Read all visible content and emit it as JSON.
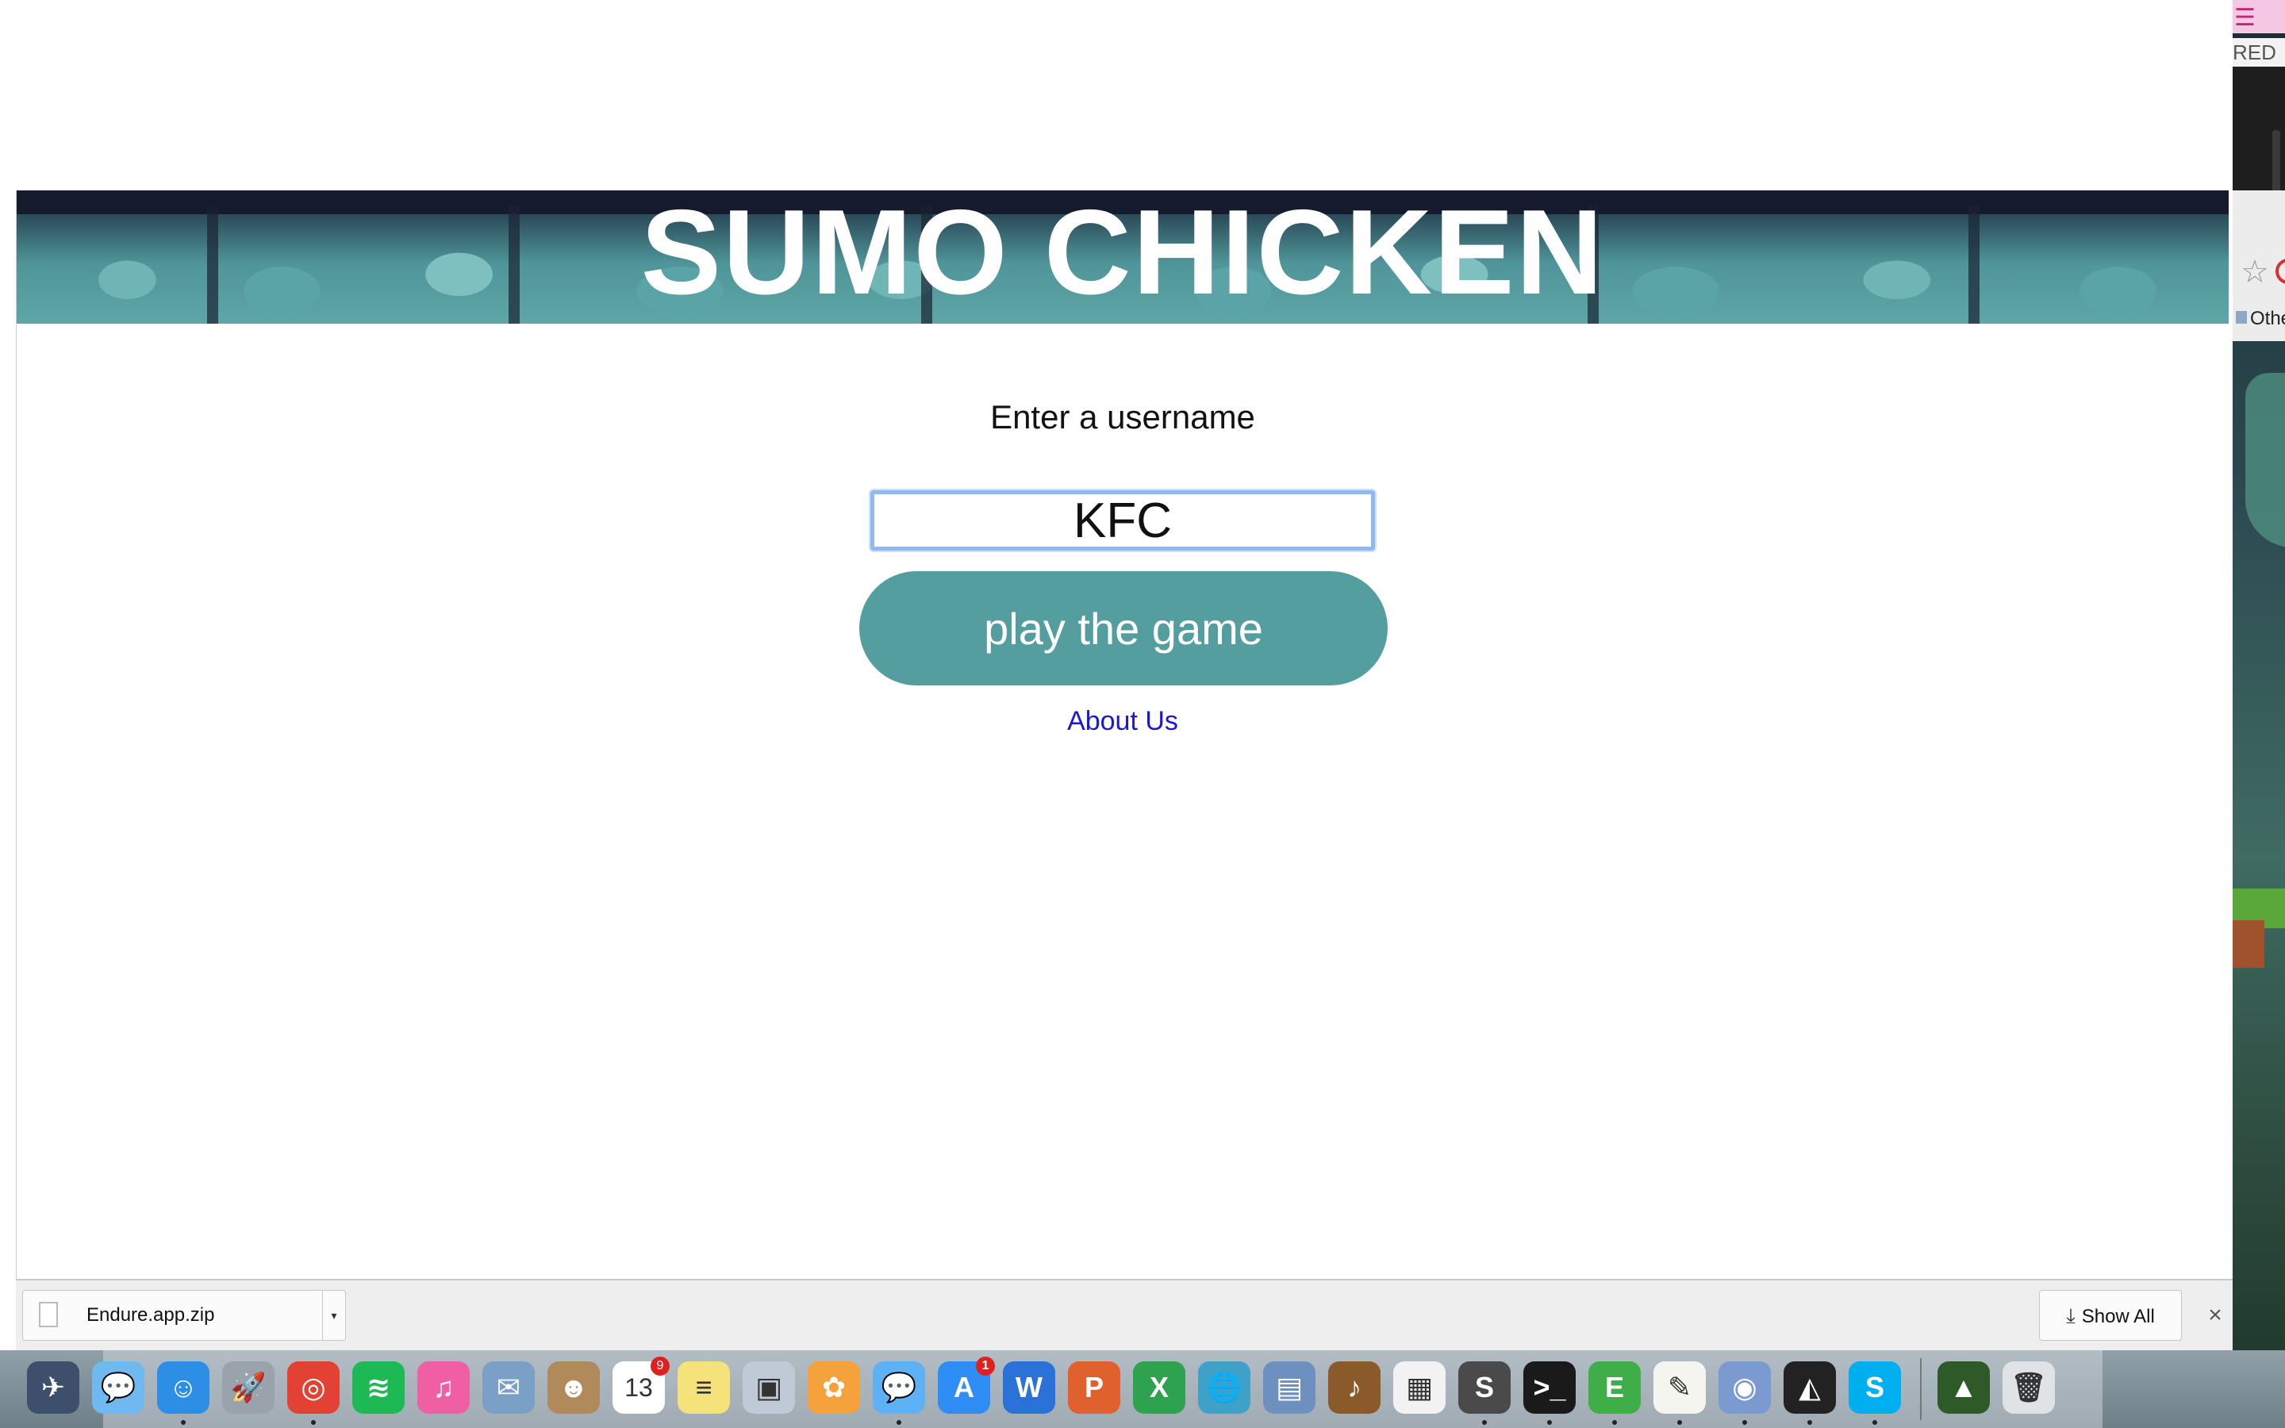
{
  "page": {
    "title": "SUMO CHICKEN",
    "prompt_label": "Enter a username",
    "username_value": "KFC",
    "play_button": "play the game",
    "about_link": "About Us"
  },
  "downloads_bar": {
    "file_name": "Endure.app.zip",
    "show_all": "Show All",
    "close_glyph": "×",
    "menu_glyph": "▾"
  },
  "background_window": {
    "partial_label": "RED",
    "partial_bookmark": "Othe"
  },
  "dock": {
    "icons": [
      {
        "name": "mission-control-icon",
        "glyph": "✈",
        "color": "#3d4f6b"
      },
      {
        "name": "messages-icon",
        "glyph": "💬",
        "color": "#6fb8f0"
      },
      {
        "name": "finder-icon",
        "glyph": "☺",
        "color": "#2d8ee6"
      },
      {
        "name": "launchpad-icon",
        "glyph": "🚀",
        "color": "#9aa2ab"
      },
      {
        "name": "chrome-icon",
        "glyph": "◎",
        "color": "#e34133"
      },
      {
        "name": "spotify-icon",
        "glyph": "≋",
        "color": "#1db954"
      },
      {
        "name": "itunes-icon",
        "glyph": "♫",
        "color": "#f05fa4"
      },
      {
        "name": "mail-icon",
        "glyph": "✉",
        "color": "#7aa0c8"
      },
      {
        "name": "contacts-icon",
        "glyph": "☻",
        "color": "#b08a5a"
      },
      {
        "name": "calendar-icon",
        "glyph": "13",
        "color": "#ffffff",
        "badge": "9"
      },
      {
        "name": "notes-icon",
        "glyph": "≡",
        "color": "#f5e27a"
      },
      {
        "name": "preview-icon",
        "glyph": "▣",
        "color": "#c0cad6"
      },
      {
        "name": "photos-icon",
        "glyph": "✿",
        "color": "#f6a23c"
      },
      {
        "name": "messages-bubble-icon",
        "glyph": "💬",
        "color": "#5eb1f5"
      },
      {
        "name": "app-store-icon",
        "glyph": "A",
        "color": "#2f8ef5",
        "badge": "1"
      },
      {
        "name": "word-icon",
        "glyph": "W",
        "color": "#2b72d8"
      },
      {
        "name": "powerpoint-icon",
        "glyph": "P",
        "color": "#e0602e"
      },
      {
        "name": "excel-icon",
        "glyph": "X",
        "color": "#2ea24e"
      },
      {
        "name": "network-globe-icon",
        "glyph": "🌐",
        "color": "#3fa0c8"
      },
      {
        "name": "remote-desktop-icon",
        "glyph": "▤",
        "color": "#6d90c0"
      },
      {
        "name": "garageband-icon",
        "glyph": "♪",
        "color": "#8a5a2a"
      },
      {
        "name": "app-grid-icon",
        "glyph": "▦",
        "color": "#f2f2f2"
      },
      {
        "name": "sublime-text-icon",
        "glyph": "S",
        "color": "#4a4a4a"
      },
      {
        "name": "terminal-icon",
        "glyph": ">_",
        "color": "#1a1a1a"
      },
      {
        "name": "evernote-icon",
        "glyph": "E",
        "color": "#3fae49"
      },
      {
        "name": "textedit-icon",
        "glyph": "✎",
        "color": "#f5f5f0"
      },
      {
        "name": "game-center-icon",
        "glyph": "◉",
        "color": "#7a9ad0"
      },
      {
        "name": "unity-icon",
        "glyph": "◭",
        "color": "#222222"
      },
      {
        "name": "skype-icon",
        "glyph": "S",
        "color": "#00aff0"
      },
      {
        "name": "game-app-icon",
        "glyph": "▲",
        "color": "#2e5a2a"
      },
      {
        "name": "trash-icon",
        "glyph": "🗑",
        "color": "#dfe3e6"
      }
    ]
  },
  "colors": {
    "play_button": "#559e9f",
    "banner_dark": "#151b2c",
    "link": "#1a18d8",
    "input_focus": "#8fb9f0"
  }
}
